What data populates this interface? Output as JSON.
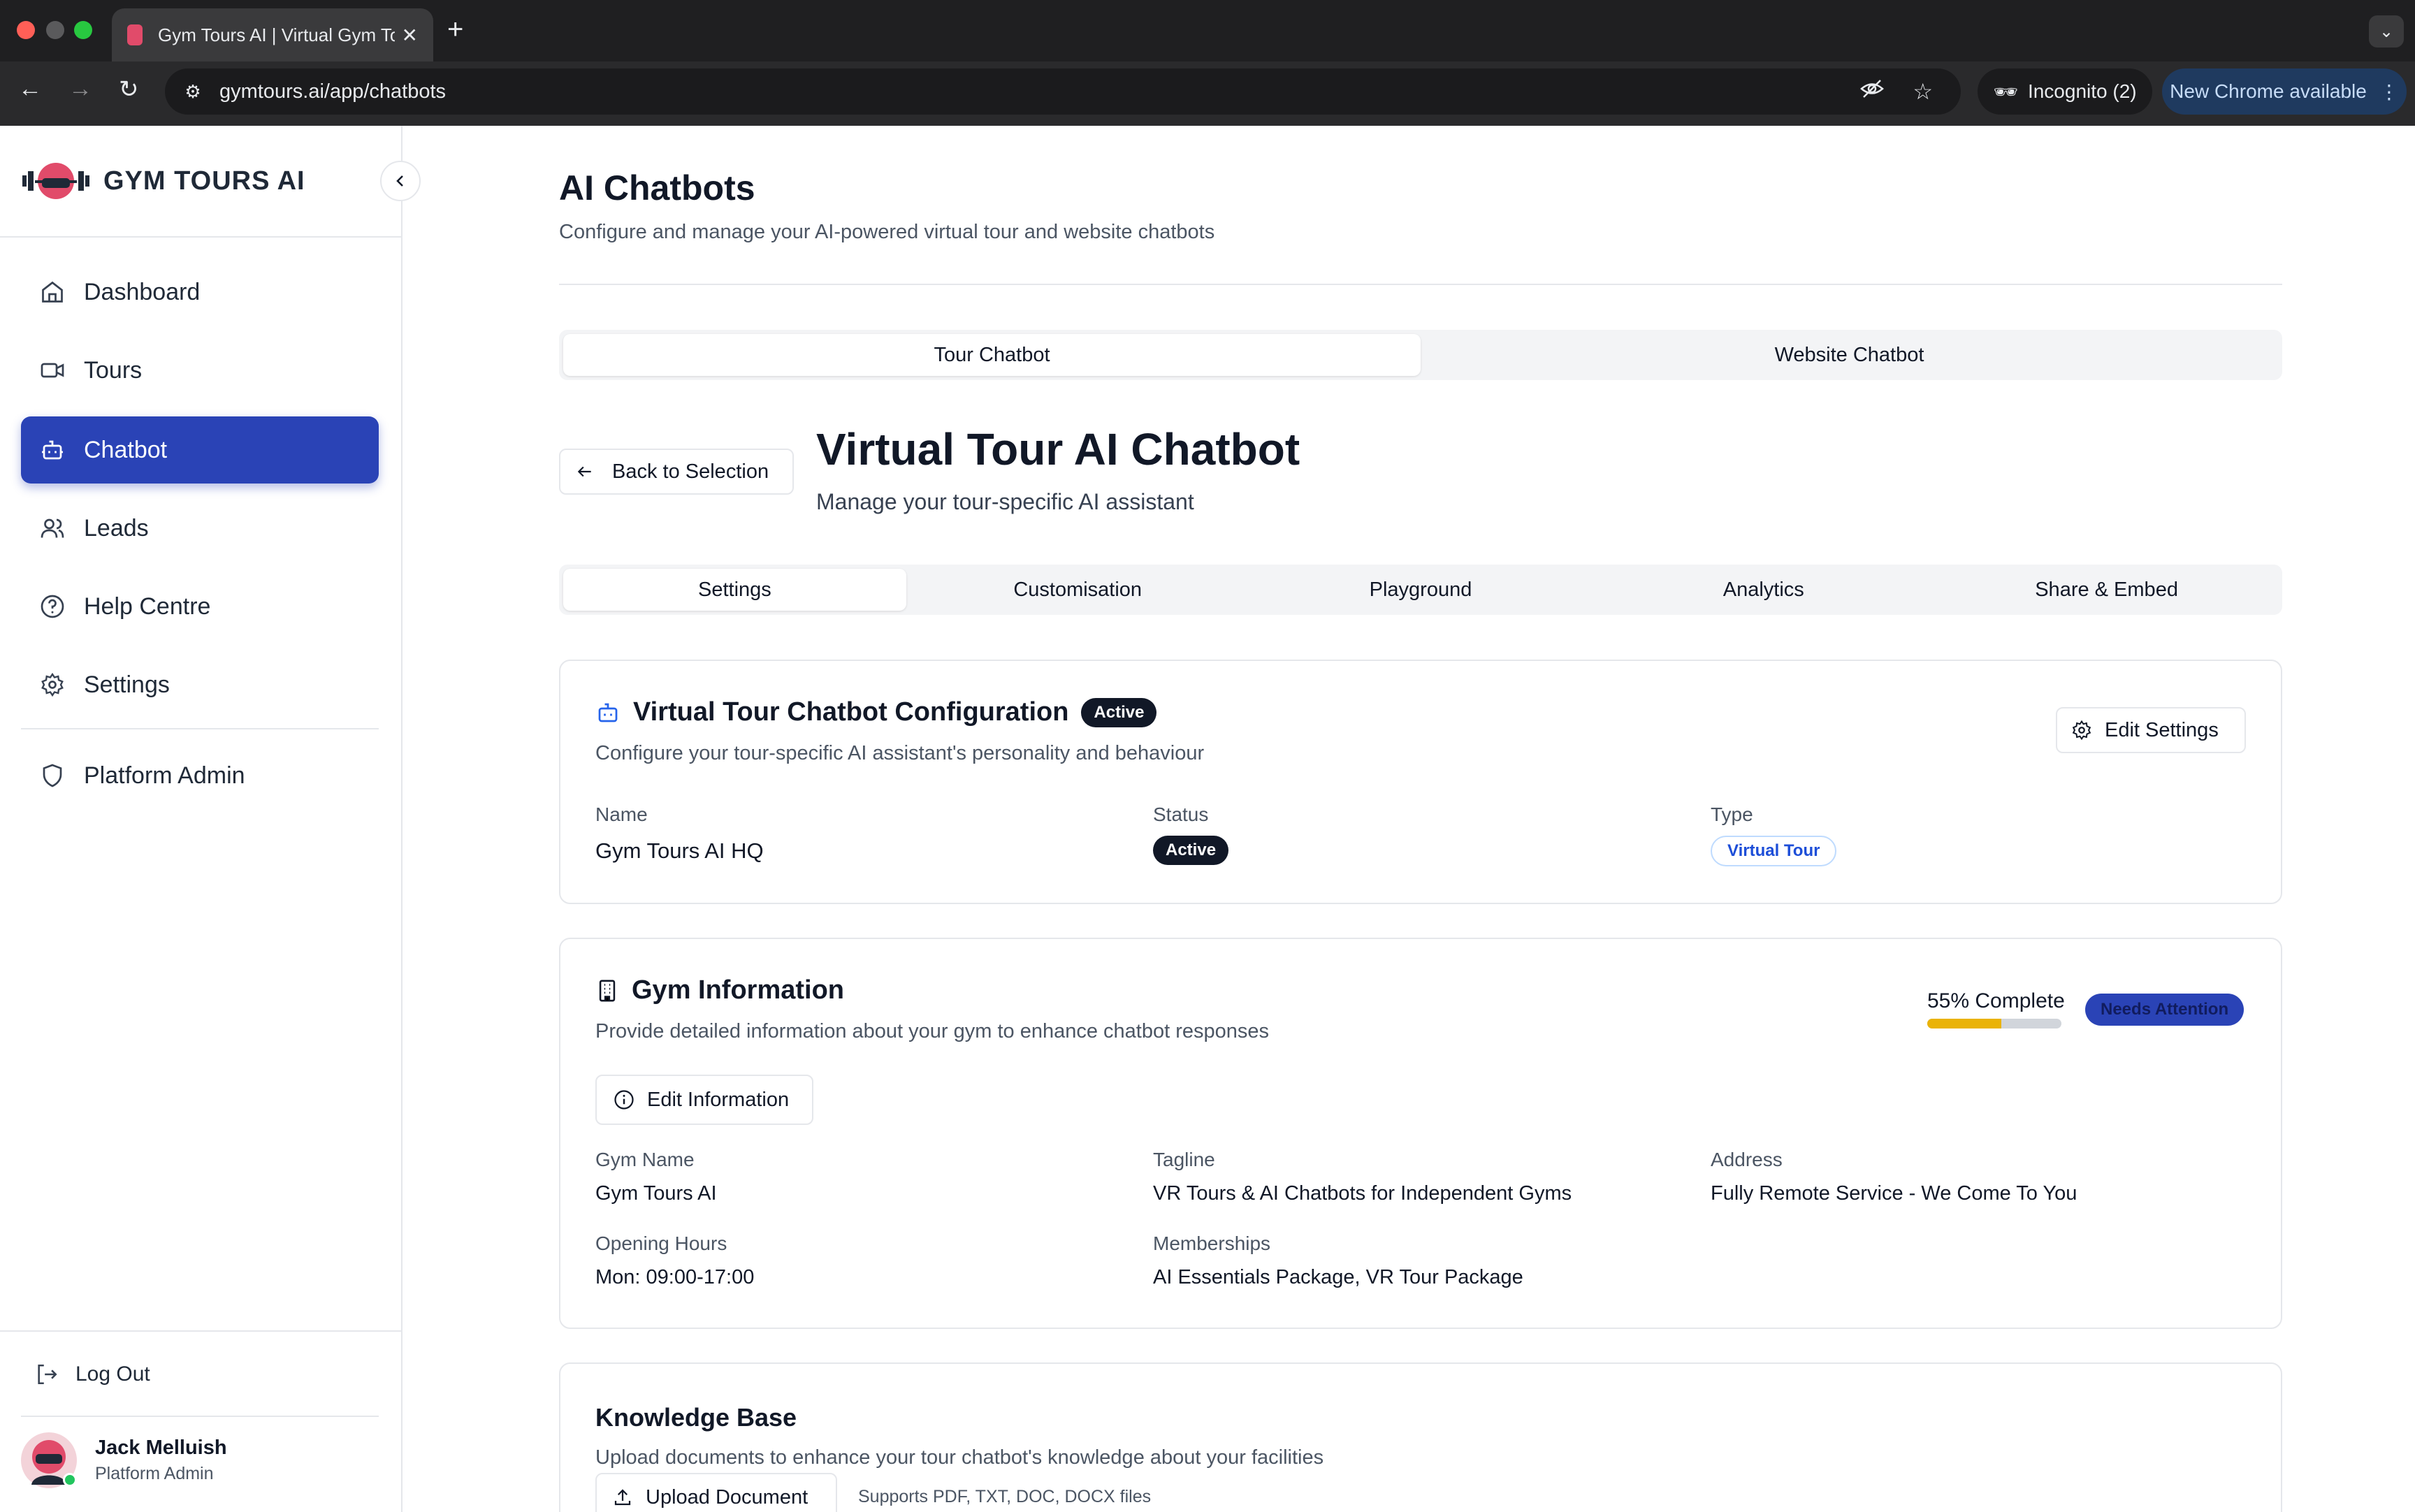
{
  "browser": {
    "tab_title": "Gym Tours AI | Virtual Gym To",
    "url": "gymtours.ai/app/chatbots",
    "incognito_label": "Incognito (2)",
    "update_label": "New Chrome available"
  },
  "sidebar": {
    "logo_text": "GYM TOURS AI",
    "items": [
      {
        "label": "Dashboard",
        "icon": "home-icon"
      },
      {
        "label": "Tours",
        "icon": "video-icon"
      },
      {
        "label": "Chatbot",
        "icon": "bot-icon",
        "active": true
      },
      {
        "label": "Leads",
        "icon": "users-icon"
      },
      {
        "label": "Help Centre",
        "icon": "help-circle-icon"
      },
      {
        "label": "Settings",
        "icon": "gear-icon"
      }
    ],
    "admin_item": {
      "label": "Platform Admin",
      "icon": "shield-icon"
    },
    "logout_label": "Log Out",
    "user": {
      "name": "Jack Melluish",
      "role": "Platform Admin"
    }
  },
  "page": {
    "title": "AI Chatbots",
    "subtitle": "Configure and manage your AI-powered virtual tour and website chatbots",
    "chatbot_tabs": [
      "Tour Chatbot",
      "Website Chatbot"
    ],
    "back_label": "Back to Selection",
    "heading": "Virtual Tour AI Chatbot",
    "heading_sub": "Manage your tour-specific AI assistant",
    "tabs": [
      "Settings",
      "Customisation",
      "Playground",
      "Analytics",
      "Share & Embed"
    ]
  },
  "config_card": {
    "title": "Virtual Tour Chatbot Configuration",
    "badge": "Active",
    "description": "Configure your tour-specific AI assistant's personality and behaviour",
    "edit_label": "Edit Settings",
    "name_label": "Name",
    "name_value": "Gym Tours AI HQ",
    "status_label": "Status",
    "status_value": "Active",
    "type_label": "Type",
    "type_value": "Virtual Tour"
  },
  "gym_card": {
    "title": "Gym Information",
    "description": "Provide detailed information about your gym to enhance chatbot responses",
    "progress_label": "55% Complete",
    "progress_fraction": 0.55,
    "attention_label": "Needs Attention",
    "edit_label": "Edit Information",
    "fields": {
      "gym_name_label": "Gym Name",
      "gym_name": "Gym Tours AI",
      "tagline_label": "Tagline",
      "tagline": "VR Tours & AI Chatbots for Independent Gyms",
      "address_label": "Address",
      "address": "Fully Remote Service - We Come To You",
      "hours_label": "Opening Hours",
      "hours": "Mon: 09:00-17:00",
      "memberships_label": "Memberships",
      "memberships": "AI Essentials Package, VR Tour Package"
    }
  },
  "kb_card": {
    "title": "Knowledge Base",
    "description": "Upload documents to enhance your tour chatbot's knowledge about your facilities",
    "upload_label": "Upload Document",
    "supports_text": "Supports PDF, TXT, DOC, DOCX files"
  },
  "colors": {
    "accent": "#2a43b6",
    "progress": "#eab308",
    "badge_dark": "#111827"
  }
}
